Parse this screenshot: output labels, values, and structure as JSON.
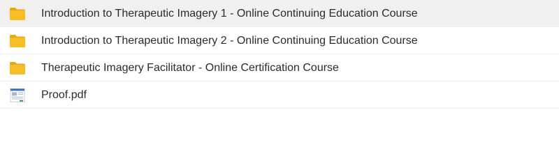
{
  "files": [
    {
      "name": "Introduction to Therapeutic Imagery 1 - Online Continuing Education Course",
      "icon": "folder-icon",
      "type": "folder",
      "selected": true
    },
    {
      "name": "Introduction to Therapeutic Imagery 2 - Online Continuing Education Course",
      "icon": "folder-icon",
      "type": "folder",
      "selected": false
    },
    {
      "name": "Therapeutic Imagery Facilitator - Online Certification Course",
      "icon": "folder-icon",
      "type": "folder",
      "selected": false
    },
    {
      "name": "Proof.pdf",
      "icon": "pdf-document-icon",
      "type": "file",
      "selected": false
    }
  ],
  "colors": {
    "folder": "#f5b81c",
    "folder_tab": "#e9a812",
    "selected_row": "#f0f0f0",
    "text": "#2b2b2b",
    "divider": "#eeeeee"
  }
}
